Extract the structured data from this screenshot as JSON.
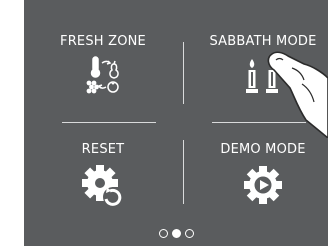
{
  "menu": {
    "items": [
      {
        "label": "FRESH ZONE",
        "icon": "fresh-zone-icon"
      },
      {
        "label": "SABBATH MODE",
        "icon": "candles-icon"
      },
      {
        "label": "RESET",
        "icon": "reset-gear-icon"
      },
      {
        "label": "DEMO MODE",
        "icon": "demo-gear-play-icon"
      }
    ]
  },
  "pager": {
    "pages": 3,
    "active_index": 1
  },
  "colors": {
    "background": "#5a5c5e",
    "foreground": "#ffffff",
    "divider": "#d9dadb"
  }
}
